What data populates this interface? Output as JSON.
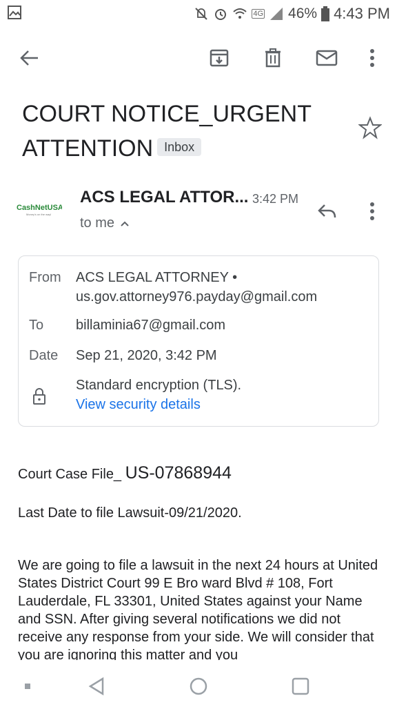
{
  "status_bar": {
    "left_icon": "image-icon",
    "right_icons": [
      "mute-icon",
      "alarm-icon",
      "wifi-icon",
      "lte-icon",
      "signal-icon"
    ],
    "lte_label": "4G",
    "battery_percent": "46%",
    "time": "4:43 PM"
  },
  "toolbar": {
    "back_icon": "back-arrow-icon",
    "archive_icon": "archive-icon",
    "delete_icon": "trash-icon",
    "mark_unread_icon": "mail-icon",
    "more_icon": "more-vert-icon"
  },
  "email": {
    "subject_line1": "COURT NOTICE_URGENT",
    "subject_line2": "ATTENTION",
    "label_chip": "Inbox",
    "avatar_text": "CashNetUSA.",
    "avatar_tagline": "Money's on the way!",
    "sender_name": "ACS LEGAL ATTOR...",
    "time": "3:42 PM",
    "to_me": "to me"
  },
  "details": {
    "from_label": "From",
    "from_name": "ACS LEGAL ATTORNEY •",
    "from_email": "us.gov.attorney976.payday@gmail.com",
    "to_label": "To",
    "to_value": "billaminia67@gmail.com",
    "date_label": "Date",
    "date_value": "Sep 21, 2020, 3:42 PM",
    "encryption": "Standard encryption (TLS).",
    "security_link": "View security details"
  },
  "body": {
    "case_prefix": "Court Case File_ ",
    "case_number": "US-07868944",
    "last_date": "Last Date to file Lawsuit-09/21/2020.",
    "paragraph": "We are going to file a lawsuit in the next 24 hours at United States District Court 99 E Bro ward Blvd # 108, Fort Lauderdale, FL 33301, United States against your Name and SSN. After giving several notifications we did not receive any response from your side. We will consider that you are ignoring this matter and you"
  },
  "colors": {
    "text": "#202124",
    "secondary": "#5f6368",
    "link": "#1a73e8",
    "border": "#dadce0",
    "chip_bg": "#e8eaed"
  }
}
